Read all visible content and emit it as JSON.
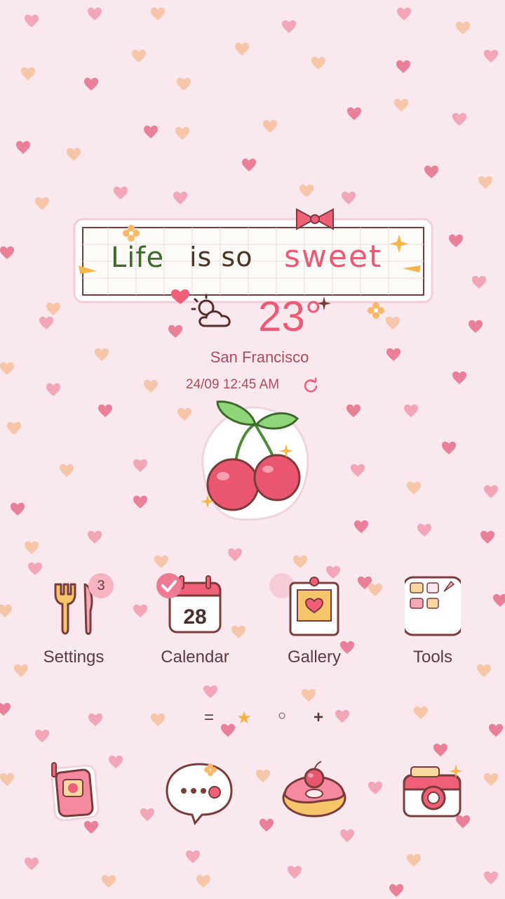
{
  "widget": {
    "banner": {
      "word1": "Life",
      "word2": "is so",
      "word3": "sweet"
    },
    "weather": {
      "temperature": "23°",
      "icon": "cloudy-sun-icon"
    },
    "city": "San Francisco",
    "datetime": "24/09 12:45 AM"
  },
  "apps": [
    {
      "label": "Settings",
      "icon": "fork-knife-icon",
      "badge": "3"
    },
    {
      "label": "Calendar",
      "icon": "calendar-icon",
      "date": "28"
    },
    {
      "label": "Gallery",
      "icon": "photo-frame-icon"
    },
    {
      "label": "Tools",
      "icon": "folder-icon"
    }
  ],
  "pager": {
    "menu": "=",
    "home": "★",
    "page": "○",
    "add": "+"
  },
  "dock": [
    {
      "icon": "phone-icon"
    },
    {
      "icon": "message-bubble-icon"
    },
    {
      "icon": "donut-icon"
    },
    {
      "icon": "camera-icon"
    }
  ],
  "colors": {
    "background": "#f9e9ef",
    "accent": "#ec5a76",
    "text": "#5a3a3f"
  }
}
